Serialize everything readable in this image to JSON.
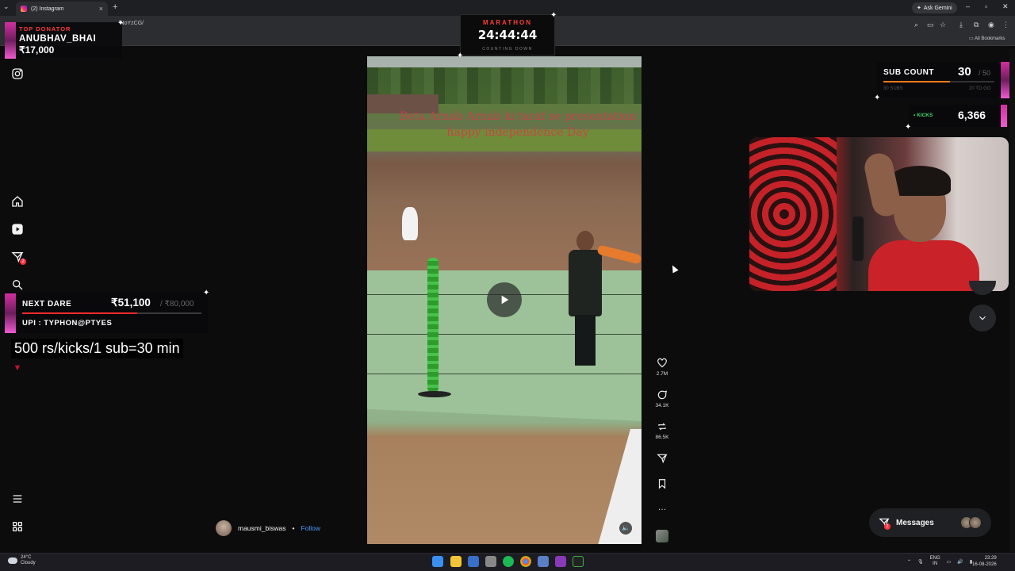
{
  "browser": {
    "tab_title": "(2) Instagram",
    "tab_close": "×",
    "new_tab": "+",
    "url": "lNoYzCG/",
    "ask_gemini": "Ask Gemini",
    "all_bookmarks": "All Bookmarks",
    "win_min": "–",
    "win_max": "▫",
    "win_close": "✕"
  },
  "overlays": {
    "top_donator": {
      "label": "TOP DONATOR",
      "name": "ANUBHAV_BHAI",
      "amount": "₹17,000"
    },
    "marathon": {
      "label": "MARATHON",
      "time": "24:44:44",
      "sub": "COUNTING DOWN"
    },
    "sub_count": {
      "label": "SUB COUNT",
      "value": "30",
      "max": "/ 50",
      "progress": 0.6,
      "foot_left": "30 SUBS",
      "foot_right": "20 TO GO"
    },
    "kicks": {
      "label": "• KICKS",
      "value": "6,366"
    },
    "next_dare": {
      "label": "NEXT DARE",
      "value": "₹51,100",
      "max": "/ ₹80,000",
      "progress": 0.64,
      "upi": "UPI : TYPHON@PTYES"
    },
    "rules_text": "500 rs/kicks/1 sub=30 min"
  },
  "post": {
    "caption": "Beta Arnab Arnab ki taraf se presentation happy independence Day",
    "author": "mausmi_biswas",
    "follow_sep": "•",
    "follow": "Follow",
    "likes": "2.7M",
    "comments": "34.1K",
    "reposts": "86.5K",
    "more": "…"
  },
  "sidebar": {
    "notif_count": "2"
  },
  "messages": {
    "label": "Messages",
    "badge": "2"
  },
  "taskbar": {
    "temp": "24°C",
    "condition": "Cloudy",
    "lang1": "ENG",
    "lang2": "IN",
    "time": "23:29",
    "date": "16-08-2026"
  },
  "colors": {
    "accent_red": "#ff3a3a",
    "kicks_green": "#3fd66b",
    "instagram_blue": "#4a9cff",
    "overlay_pink": "#d12fa0"
  }
}
